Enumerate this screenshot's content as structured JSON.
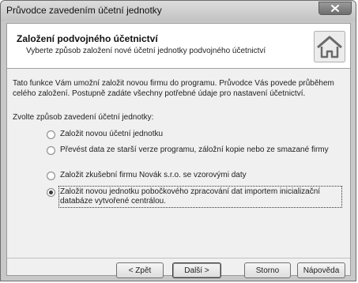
{
  "window": {
    "title": "Průvodce zavedením účetní jednotky"
  },
  "header": {
    "title": "Založení podvojného účetnictví",
    "subtitle": "Vyberte způsob založení nové účetní jednotky podvojného účetnictví",
    "icon": "home-icon"
  },
  "body": {
    "intro": "Tato funkce Vám umožní založit novou firmu do programu. Průvodce Vás povede průběhem celého založení. Postupně zadáte všechny potřebné údaje pro nastavení účetnictví.",
    "choose_label": "Zvolte způsob zavedení účetní jednotky:",
    "options": [
      {
        "label": "Založit novou účetní jednotku",
        "selected": false
      },
      {
        "label": "Převést data ze starší verze programu, záložní kopie nebo ze smazané firmy",
        "selected": false
      },
      {
        "label": "Založit zkušební firmu Novák s.r.o. se vzorovými daty",
        "selected": false
      },
      {
        "label": "Založit novou jednotku pobočkového zpracování dat importem inicializační databáze vytvořené centrálou.",
        "selected": true
      }
    ]
  },
  "buttons": {
    "back": "< Zpět",
    "next": "Další >",
    "cancel": "Storno",
    "help": "Nápověda"
  }
}
